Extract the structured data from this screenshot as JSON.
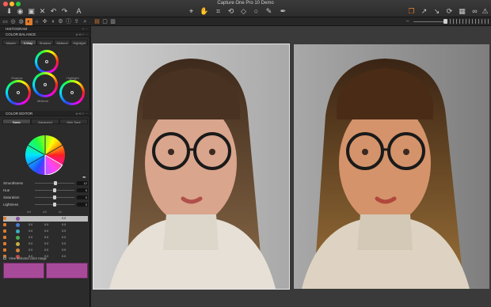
{
  "app": {
    "title": "Capture One Pro 10 Demo"
  },
  "left_panel": {
    "sections": {
      "histogram": "HISTOGRAM",
      "color_balance": "COLOR BALANCE",
      "color_editor": "COLOR EDITOR"
    },
    "color_balance_tabs": [
      "Master",
      "3-Way",
      "Shadow",
      "Midtone",
      "Highlight"
    ],
    "color_balance_active_tab": "3-Way",
    "wheel_labels": {
      "shadow": "Shadow",
      "midtone": "Midtone",
      "highlight": "Highlight"
    },
    "color_editor_tabs": [
      "Basic",
      "Advanced",
      "Skin Tone"
    ],
    "color_editor_active_tab": "Basic",
    "sliders": [
      {
        "label": "Smoothness",
        "value": "12"
      },
      {
        "label": "Hue",
        "value": "0"
      },
      {
        "label": "Saturation",
        "value": "0"
      },
      {
        "label": "Lightness",
        "value": "0"
      }
    ],
    "table_headers": [
      "ΔH",
      "ΔS",
      "ΔL"
    ],
    "table_rows": [
      {
        "color": "#8a4fa8",
        "h": "",
        "s": "",
        "l": "0.0",
        "selected": true
      },
      {
        "color": "#4a7ad0",
        "h": "0.0",
        "s": "0.0",
        "l": "0.0",
        "selected": false
      },
      {
        "color": "#3ab0c0",
        "h": "0.0",
        "s": "0.0",
        "l": "0.0",
        "selected": false
      },
      {
        "color": "#4ab050",
        "h": "0.0",
        "s": "0.0",
        "l": "0.0",
        "selected": false
      },
      {
        "color": "#c8b040",
        "h": "0.0",
        "s": "0.0",
        "l": "0.0",
        "selected": false
      },
      {
        "color": "#d08040",
        "h": "0.0",
        "s": "0.0",
        "l": "0.0",
        "selected": false
      },
      {
        "color": "#c04a4a",
        "h": "0.0",
        "s": "0.0",
        "l": "0.0",
        "selected": false
      }
    ],
    "new_range_label": "View selected color range",
    "range_swatch_color": "#a84a9a"
  },
  "colors": {
    "accent": "#e07b2a",
    "panel": "#2b2b2b",
    "viewer": "#3a3a3a"
  },
  "viewer": {
    "images": [
      {
        "name": "before",
        "selected": true
      },
      {
        "name": "after",
        "selected": false
      }
    ]
  }
}
